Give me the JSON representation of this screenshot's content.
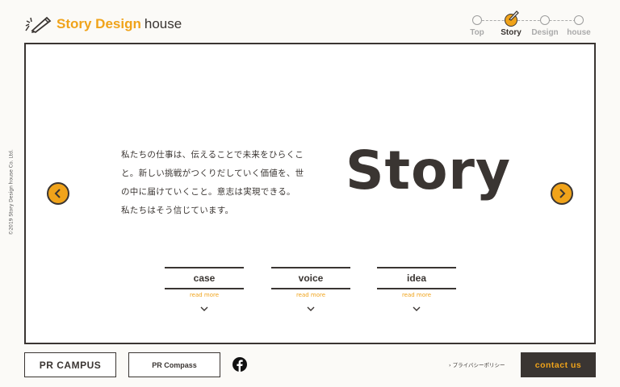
{
  "logo": {
    "brand_a": "Story Design",
    "brand_b": "house",
    "icon": "pen-icon"
  },
  "steps": [
    {
      "label": "Top",
      "active": false
    },
    {
      "label": "Story",
      "active": true
    },
    {
      "label": "Design",
      "active": false
    },
    {
      "label": "house",
      "active": false
    }
  ],
  "copyright": "©2019 Story Design house Co. Ltd.",
  "main": {
    "title": "Story",
    "intro_lines": [
      "私たちの仕事は、伝えることで未来をひらくこ",
      "と。新しい挑戦がつくりだしていく価値を、世",
      "の中に届けていくこと。意志は実現できる。",
      "私たちはそう信じています。"
    ],
    "cards": [
      {
        "title": "case",
        "more": "read more"
      },
      {
        "title": "voice",
        "more": "read more"
      },
      {
        "title": "idea",
        "more": "read more"
      }
    ]
  },
  "footer": {
    "pr_campus": "PR CAMPUS",
    "pr_compass": "PR Compass",
    "privacy": "› プライバシーポリシー",
    "contact": "contact us"
  },
  "colors": {
    "accent": "#f0a31a",
    "dark": "#3a3532",
    "bg": "#fbfaf7"
  }
}
